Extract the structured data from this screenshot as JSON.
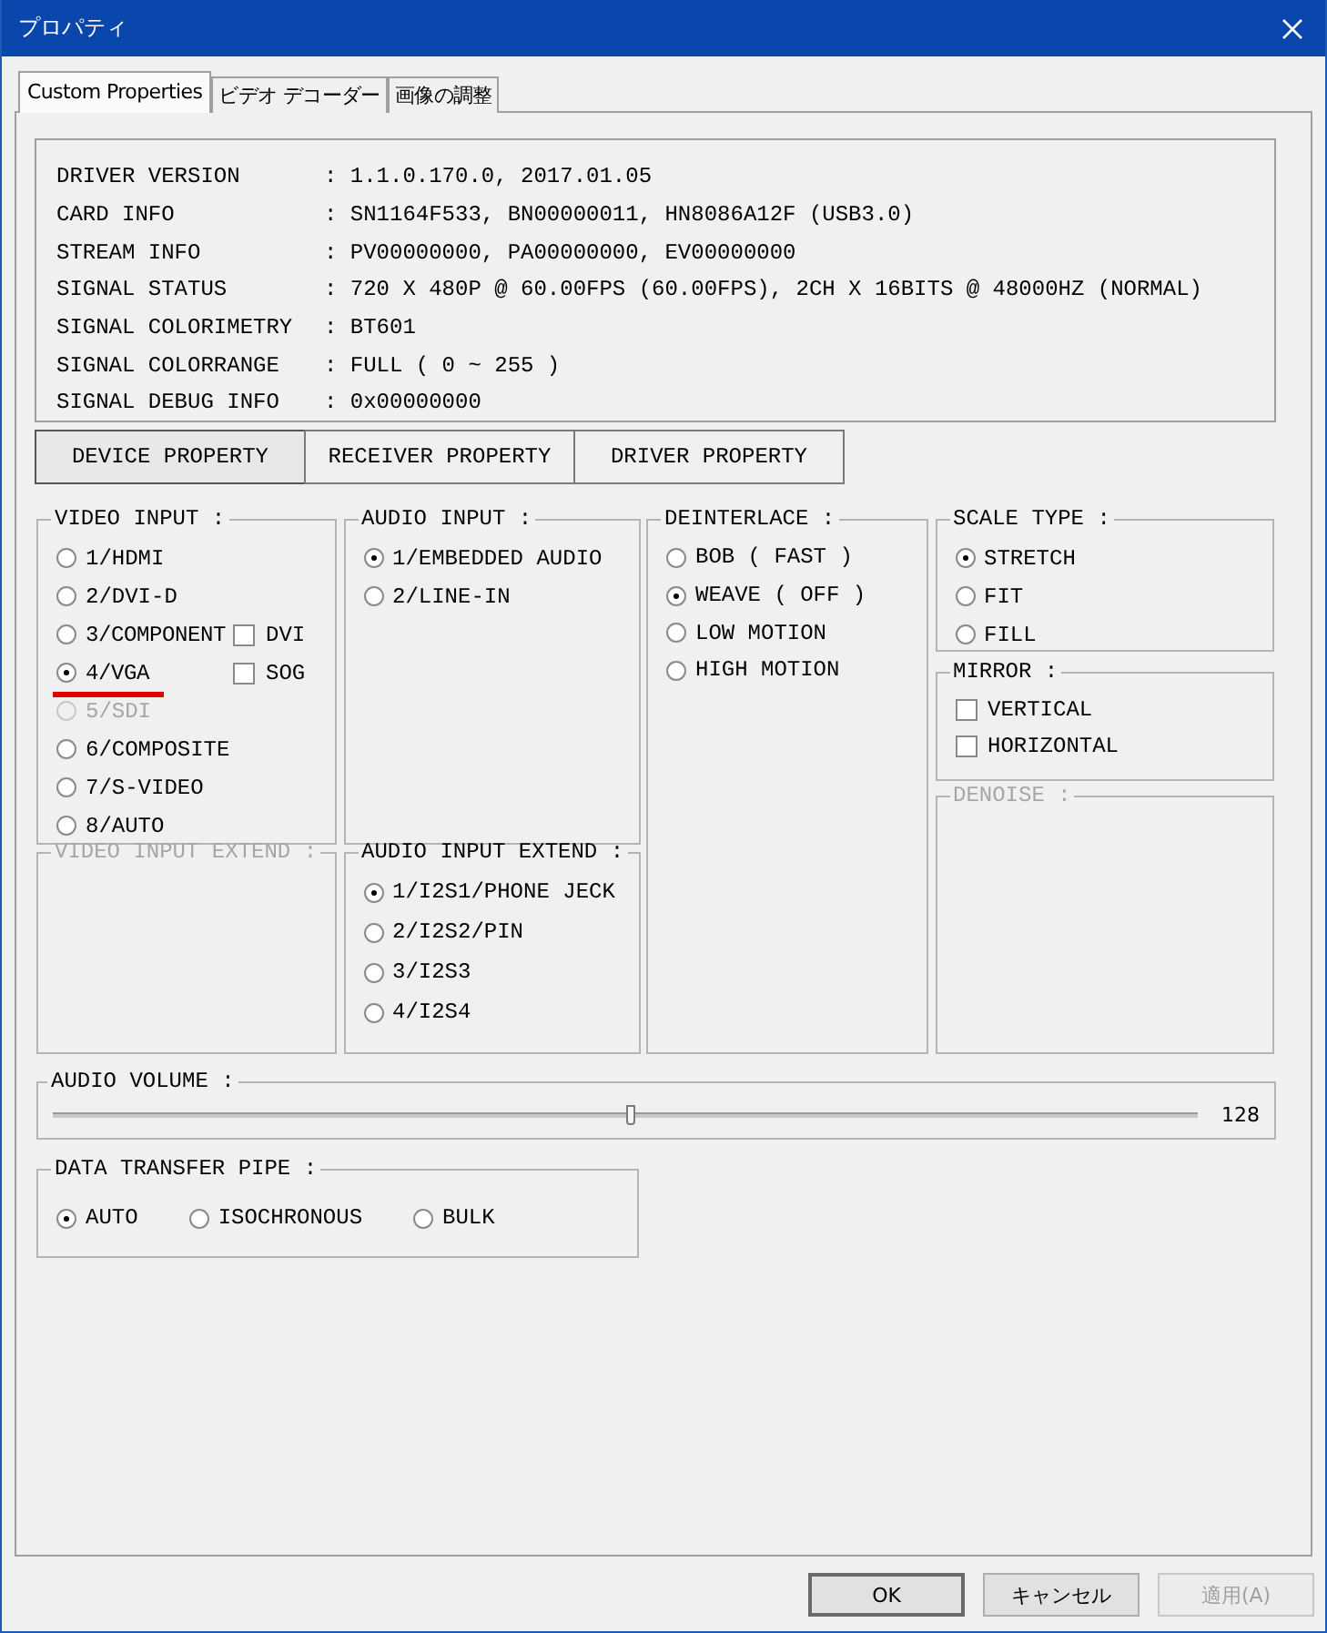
{
  "window": {
    "title": "プロパティ"
  },
  "tabs": [
    {
      "label": "Custom Properties",
      "selected": true
    },
    {
      "label": "ビデオ デコーダー",
      "selected": false
    },
    {
      "label": "画像の調整",
      "selected": false
    }
  ],
  "info": [
    {
      "label": "DRIVER VERSION",
      "value": ": 1.1.0.170.0, 2017.01.05"
    },
    {
      "label": "CARD INFO",
      "value": ": SN1164F533, BN00000011, HN8086A12F (USB3.0)"
    },
    {
      "label": "STREAM INFO",
      "value": ": PV00000000, PA00000000, EV00000000"
    },
    {
      "label": "SIGNAL STATUS",
      "value": ": 720 X 480P @ 60.00FPS (60.00FPS), 2CH X 16BITS @ 48000HZ (NORMAL)"
    },
    {
      "label": "SIGNAL COLORIMETRY",
      "value": ": BT601"
    },
    {
      "label": "SIGNAL COLORRANGE",
      "value": ": FULL ( 0 ~ 255 )"
    },
    {
      "label": "SIGNAL DEBUG INFO",
      "value": ": 0x00000000"
    }
  ],
  "property_buttons": [
    {
      "label": "DEVICE PROPERTY",
      "selected": true
    },
    {
      "label": "RECEIVER PROPERTY",
      "selected": false
    },
    {
      "label": "DRIVER PROPERTY",
      "selected": false
    }
  ],
  "groups": {
    "video_input": {
      "title": "VIDEO INPUT :",
      "disabled": false,
      "kind": "radio",
      "options": [
        {
          "label": "1/HDMI",
          "selected": false,
          "disabled": false,
          "highlighted": false
        },
        {
          "label": "2/DVI-D",
          "selected": false,
          "disabled": false,
          "highlighted": false
        },
        {
          "label": "3/COMPONENT",
          "selected": false,
          "disabled": false,
          "highlighted": false,
          "checkbox": {
            "label": "DVI",
            "checked": false
          }
        },
        {
          "label": "4/VGA",
          "selected": true,
          "disabled": false,
          "highlighted": true,
          "checkbox": {
            "label": "SOG",
            "checked": false
          }
        },
        {
          "label": "5/SDI",
          "selected": false,
          "disabled": true,
          "highlighted": false
        },
        {
          "label": "6/COMPOSITE",
          "selected": false,
          "disabled": false,
          "highlighted": false
        },
        {
          "label": "7/S-VIDEO",
          "selected": false,
          "disabled": false,
          "highlighted": false
        },
        {
          "label": "8/AUTO",
          "selected": false,
          "disabled": false,
          "highlighted": false
        }
      ]
    },
    "video_input_extend": {
      "title": "VIDEO INPUT EXTEND :",
      "disabled": true
    },
    "audio_input": {
      "title": "AUDIO INPUT :",
      "disabled": false,
      "kind": "radio",
      "options": [
        {
          "label": "1/EMBEDDED AUDIO",
          "selected": true
        },
        {
          "label": "2/LINE-IN",
          "selected": false
        }
      ]
    },
    "audio_input_extend": {
      "title": "AUDIO INPUT EXTEND :",
      "disabled": false,
      "kind": "radio",
      "options": [
        {
          "label": "1/I2S1/PHONE JECK",
          "selected": true
        },
        {
          "label": "2/I2S2/PIN",
          "selected": false
        },
        {
          "label": "3/I2S3",
          "selected": false
        },
        {
          "label": "4/I2S4",
          "selected": false
        }
      ]
    },
    "deinterlace": {
      "title": "DEINTERLACE :",
      "disabled": false,
      "kind": "radio",
      "options": [
        {
          "label": "BOB ( FAST )",
          "selected": false
        },
        {
          "label": "WEAVE ( OFF )",
          "selected": true
        },
        {
          "label": "LOW MOTION",
          "selected": false
        },
        {
          "label": "HIGH MOTION",
          "selected": false
        }
      ]
    },
    "scale_type": {
      "title": "SCALE TYPE :",
      "disabled": false,
      "kind": "radio",
      "options": [
        {
          "label": "STRETCH",
          "selected": true
        },
        {
          "label": "FIT",
          "selected": false
        },
        {
          "label": "FILL",
          "selected": false
        }
      ]
    },
    "mirror": {
      "title": "MIRROR :",
      "disabled": false,
      "kind": "checkbox",
      "options": [
        {
          "label": "VERTICAL",
          "checked": false
        },
        {
          "label": "HORIZONTAL",
          "checked": false
        }
      ]
    },
    "denoise": {
      "title": "DENOISE :",
      "disabled": true
    }
  },
  "audio_volume": {
    "title": "AUDIO VOLUME :",
    "level": 0.505,
    "reading": "128"
  },
  "data_transfer_pipe": {
    "title": "DATA TRANSFER PIPE :",
    "options": [
      {
        "label": "AUTO",
        "selected": true
      },
      {
        "label": "ISOCHRONOUS",
        "selected": false
      },
      {
        "label": "BULK",
        "selected": false
      }
    ]
  },
  "buttons": [
    {
      "label": "OK",
      "default": true,
      "disabled": false
    },
    {
      "label": "キャンセル",
      "default": false,
      "disabled": false
    },
    {
      "label": "適用(A)",
      "default": false,
      "disabled": true
    }
  ]
}
